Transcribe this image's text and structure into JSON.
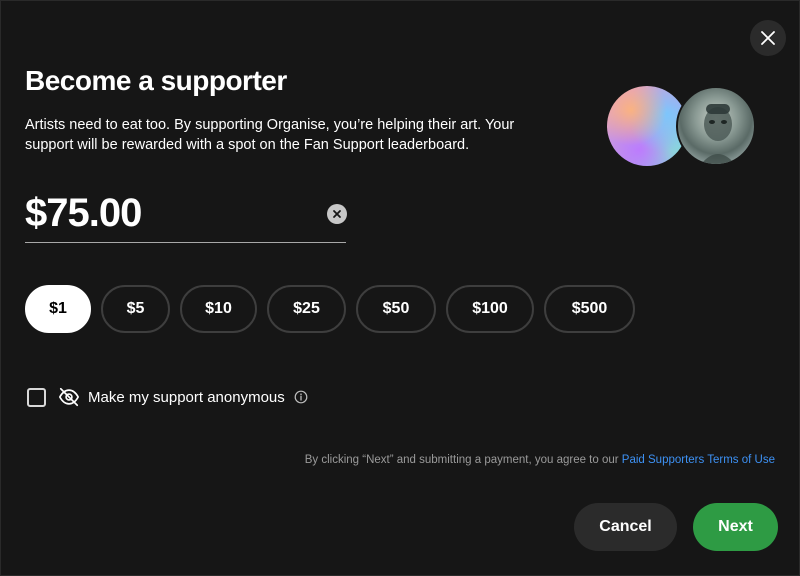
{
  "dialog": {
    "title": "Become a supporter",
    "description": "Artists need to eat too. By supporting Organise, you’re helping their art. Your support will be rewarded with a spot on the Fan Support leaderboard.",
    "avatars": [
      "gradient-avatar",
      "artist-photo-avatar"
    ],
    "close_icon": "close-icon"
  },
  "amount": {
    "value": "$75.00",
    "clear_icon": "clear-icon"
  },
  "presets": [
    {
      "label": "$1",
      "selected": true
    },
    {
      "label": "$5",
      "selected": false
    },
    {
      "label": "$10",
      "selected": false
    },
    {
      "label": "$25",
      "selected": false
    },
    {
      "label": "$50",
      "selected": false
    },
    {
      "label": "$100",
      "selected": false
    },
    {
      "label": "$500",
      "selected": false
    }
  ],
  "anonymous": {
    "label": "Make my support anonymous",
    "checked": false,
    "icon": "eye-slash-icon",
    "info_icon": "info-icon"
  },
  "terms": {
    "text": "By clicking “Next” and submitting a payment, you agree to our",
    "link": "Paid Supporters Terms of Use"
  },
  "actions": {
    "cancel": "Cancel",
    "next": "Next"
  },
  "colors": {
    "background": "#161616",
    "accent_green": "#2e9b44",
    "link_blue": "#3d91f4"
  }
}
